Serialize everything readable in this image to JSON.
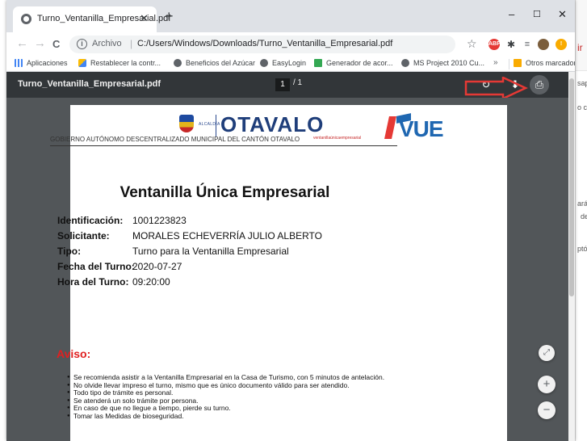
{
  "tab": {
    "title": "Turno_Ventanilla_Empresarial.pdf",
    "close": "✕",
    "new_tab": "+"
  },
  "window_controls": {
    "minimize": "–",
    "maximize": "☐",
    "close": "✕"
  },
  "nav": {
    "back": "←",
    "forward": "→",
    "reload": "C"
  },
  "omnibox": {
    "scheme_label": "Archivo",
    "url": "C:/Users/Windows/Downloads/Turno_Ventanilla_Empresarial.pdf"
  },
  "bookmarks": {
    "items": [
      {
        "label": "Aplicaciones",
        "icon": "apps-grid-icon"
      },
      {
        "label": "Restablecer la contr...",
        "icon": "extension-icon"
      },
      {
        "label": "Beneficios del Azúcar",
        "icon": "globe-icon"
      },
      {
        "label": "EasyLogin",
        "icon": "globe-icon"
      },
      {
        "label": "Generador de acor...",
        "icon": "doc-icon"
      },
      {
        "label": "MS Project 2010 Cu...",
        "icon": "globe-icon"
      }
    ],
    "overflow": "»",
    "other": "Otros marcadores"
  },
  "pdf_toolbar": {
    "filename": "Turno_Ventanilla_Empresarial.pdf",
    "current_page": "1",
    "page_total": "/ 1",
    "rotate_icon": "↻",
    "download_icon": "⬇",
    "print_icon": "⎙"
  },
  "document": {
    "alcaldia": "ALCALDÍA",
    "otavalo": "OTAVALO",
    "vue": "VUE",
    "gad": "GOBIERNO AUTÓNOMO DESCENTRALIZADO MUNICIPAL DEL CANTÓN OTAVALO",
    "vue_tagline": "ventanillaúnicaempresarial",
    "heading": "Ventanilla Única Empresarial",
    "fields": [
      {
        "key": "Identificación:",
        "value": "1001223823"
      },
      {
        "key": "Solicitante:",
        "value": "MORALES ECHEVERRÍA JULIO ALBERTO"
      },
      {
        "key": "Tipo:",
        "value": "Turno para la Ventanilla Empresarial"
      },
      {
        "key": "Fecha del Turno:",
        "value": "2020-07-27"
      },
      {
        "key": "Hora del Turno:",
        "value": "09:20:00"
      }
    ],
    "aviso": "Aviso:",
    "bullets": [
      "Se recomienda asistir a la Ventanilla Empresarial en la Casa de Turismo, con 5 minutos de antelación.",
      "No olvide llevar impreso el turno, mismo que es único documento válido para ser atendido.",
      "Todo tipo de trámite es personal.",
      "Se atenderá un solo trámite por persona.",
      "En caso de que no llegue a tiempo, pierde su turno.",
      "Tomar las Medidas de bioseguridad."
    ]
  },
  "zoom": {
    "fit": "⤢",
    "in": "+",
    "out": "−"
  },
  "background_page": {
    "fragments": [
      "ir",
      "sap",
      "o c",
      "ará",
      "de",
      "ptó"
    ]
  },
  "colors": {
    "pdf_toolbar": "#323639",
    "viewer_bg": "#525659",
    "aviso_red": "#e02020",
    "annotation_red": "#e53935"
  }
}
